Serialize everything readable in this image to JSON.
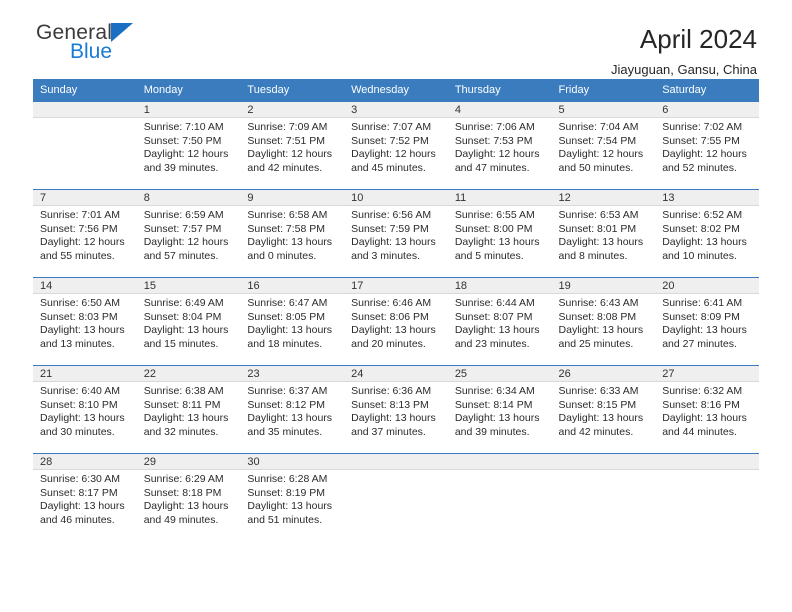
{
  "brand": {
    "name_top": "General",
    "name_bottom": "Blue",
    "triangle_color": "#1a6fc4",
    "blue_color": "#1a7ad4"
  },
  "header": {
    "title": "April 2024",
    "subtitle": "Jiayuguan, Gansu, China"
  },
  "theme": {
    "header_bg": "#3a7cbe",
    "daynum_bg": "#efefef",
    "text": "#2b2b2b"
  },
  "labels": {
    "sunrise_prefix": "Sunrise: ",
    "sunset_prefix": "Sunset: ",
    "daylight_prefix": "Daylight: "
  },
  "weekdays": [
    "Sunday",
    "Monday",
    "Tuesday",
    "Wednesday",
    "Thursday",
    "Friday",
    "Saturday"
  ],
  "weeks": [
    [
      {
        "day": ""
      },
      {
        "day": "1",
        "sunrise": "Sunrise: 7:10 AM",
        "sunset": "Sunset: 7:50 PM",
        "daylight_line1": "Daylight: 12 hours",
        "daylight_line2": "and 39 minutes."
      },
      {
        "day": "2",
        "sunrise": "Sunrise: 7:09 AM",
        "sunset": "Sunset: 7:51 PM",
        "daylight_line1": "Daylight: 12 hours",
        "daylight_line2": "and 42 minutes."
      },
      {
        "day": "3",
        "sunrise": "Sunrise: 7:07 AM",
        "sunset": "Sunset: 7:52 PM",
        "daylight_line1": "Daylight: 12 hours",
        "daylight_line2": "and 45 minutes."
      },
      {
        "day": "4",
        "sunrise": "Sunrise: 7:06 AM",
        "sunset": "Sunset: 7:53 PM",
        "daylight_line1": "Daylight: 12 hours",
        "daylight_line2": "and 47 minutes."
      },
      {
        "day": "5",
        "sunrise": "Sunrise: 7:04 AM",
        "sunset": "Sunset: 7:54 PM",
        "daylight_line1": "Daylight: 12 hours",
        "daylight_line2": "and 50 minutes."
      },
      {
        "day": "6",
        "sunrise": "Sunrise: 7:02 AM",
        "sunset": "Sunset: 7:55 PM",
        "daylight_line1": "Daylight: 12 hours",
        "daylight_line2": "and 52 minutes."
      }
    ],
    [
      {
        "day": "7",
        "sunrise": "Sunrise: 7:01 AM",
        "sunset": "Sunset: 7:56 PM",
        "daylight_line1": "Daylight: 12 hours",
        "daylight_line2": "and 55 minutes."
      },
      {
        "day": "8",
        "sunrise": "Sunrise: 6:59 AM",
        "sunset": "Sunset: 7:57 PM",
        "daylight_line1": "Daylight: 12 hours",
        "daylight_line2": "and 57 minutes."
      },
      {
        "day": "9",
        "sunrise": "Sunrise: 6:58 AM",
        "sunset": "Sunset: 7:58 PM",
        "daylight_line1": "Daylight: 13 hours",
        "daylight_line2": "and 0 minutes."
      },
      {
        "day": "10",
        "sunrise": "Sunrise: 6:56 AM",
        "sunset": "Sunset: 7:59 PM",
        "daylight_line1": "Daylight: 13 hours",
        "daylight_line2": "and 3 minutes."
      },
      {
        "day": "11",
        "sunrise": "Sunrise: 6:55 AM",
        "sunset": "Sunset: 8:00 PM",
        "daylight_line1": "Daylight: 13 hours",
        "daylight_line2": "and 5 minutes."
      },
      {
        "day": "12",
        "sunrise": "Sunrise: 6:53 AM",
        "sunset": "Sunset: 8:01 PM",
        "daylight_line1": "Daylight: 13 hours",
        "daylight_line2": "and 8 minutes."
      },
      {
        "day": "13",
        "sunrise": "Sunrise: 6:52 AM",
        "sunset": "Sunset: 8:02 PM",
        "daylight_line1": "Daylight: 13 hours",
        "daylight_line2": "and 10 minutes."
      }
    ],
    [
      {
        "day": "14",
        "sunrise": "Sunrise: 6:50 AM",
        "sunset": "Sunset: 8:03 PM",
        "daylight_line1": "Daylight: 13 hours",
        "daylight_line2": "and 13 minutes."
      },
      {
        "day": "15",
        "sunrise": "Sunrise: 6:49 AM",
        "sunset": "Sunset: 8:04 PM",
        "daylight_line1": "Daylight: 13 hours",
        "daylight_line2": "and 15 minutes."
      },
      {
        "day": "16",
        "sunrise": "Sunrise: 6:47 AM",
        "sunset": "Sunset: 8:05 PM",
        "daylight_line1": "Daylight: 13 hours",
        "daylight_line2": "and 18 minutes."
      },
      {
        "day": "17",
        "sunrise": "Sunrise: 6:46 AM",
        "sunset": "Sunset: 8:06 PM",
        "daylight_line1": "Daylight: 13 hours",
        "daylight_line2": "and 20 minutes."
      },
      {
        "day": "18",
        "sunrise": "Sunrise: 6:44 AM",
        "sunset": "Sunset: 8:07 PM",
        "daylight_line1": "Daylight: 13 hours",
        "daylight_line2": "and 23 minutes."
      },
      {
        "day": "19",
        "sunrise": "Sunrise: 6:43 AM",
        "sunset": "Sunset: 8:08 PM",
        "daylight_line1": "Daylight: 13 hours",
        "daylight_line2": "and 25 minutes."
      },
      {
        "day": "20",
        "sunrise": "Sunrise: 6:41 AM",
        "sunset": "Sunset: 8:09 PM",
        "daylight_line1": "Daylight: 13 hours",
        "daylight_line2": "and 27 minutes."
      }
    ],
    [
      {
        "day": "21",
        "sunrise": "Sunrise: 6:40 AM",
        "sunset": "Sunset: 8:10 PM",
        "daylight_line1": "Daylight: 13 hours",
        "daylight_line2": "and 30 minutes."
      },
      {
        "day": "22",
        "sunrise": "Sunrise: 6:38 AM",
        "sunset": "Sunset: 8:11 PM",
        "daylight_line1": "Daylight: 13 hours",
        "daylight_line2": "and 32 minutes."
      },
      {
        "day": "23",
        "sunrise": "Sunrise: 6:37 AM",
        "sunset": "Sunset: 8:12 PM",
        "daylight_line1": "Daylight: 13 hours",
        "daylight_line2": "and 35 minutes."
      },
      {
        "day": "24",
        "sunrise": "Sunrise: 6:36 AM",
        "sunset": "Sunset: 8:13 PM",
        "daylight_line1": "Daylight: 13 hours",
        "daylight_line2": "and 37 minutes."
      },
      {
        "day": "25",
        "sunrise": "Sunrise: 6:34 AM",
        "sunset": "Sunset: 8:14 PM",
        "daylight_line1": "Daylight: 13 hours",
        "daylight_line2": "and 39 minutes."
      },
      {
        "day": "26",
        "sunrise": "Sunrise: 6:33 AM",
        "sunset": "Sunset: 8:15 PM",
        "daylight_line1": "Daylight: 13 hours",
        "daylight_line2": "and 42 minutes."
      },
      {
        "day": "27",
        "sunrise": "Sunrise: 6:32 AM",
        "sunset": "Sunset: 8:16 PM",
        "daylight_line1": "Daylight: 13 hours",
        "daylight_line2": "and 44 minutes."
      }
    ],
    [
      {
        "day": "28",
        "sunrise": "Sunrise: 6:30 AM",
        "sunset": "Sunset: 8:17 PM",
        "daylight_line1": "Daylight: 13 hours",
        "daylight_line2": "and 46 minutes."
      },
      {
        "day": "29",
        "sunrise": "Sunrise: 6:29 AM",
        "sunset": "Sunset: 8:18 PM",
        "daylight_line1": "Daylight: 13 hours",
        "daylight_line2": "and 49 minutes."
      },
      {
        "day": "30",
        "sunrise": "Sunrise: 6:28 AM",
        "sunset": "Sunset: 8:19 PM",
        "daylight_line1": "Daylight: 13 hours",
        "daylight_line2": "and 51 minutes."
      },
      {
        "day": ""
      },
      {
        "day": ""
      },
      {
        "day": ""
      },
      {
        "day": ""
      }
    ]
  ]
}
